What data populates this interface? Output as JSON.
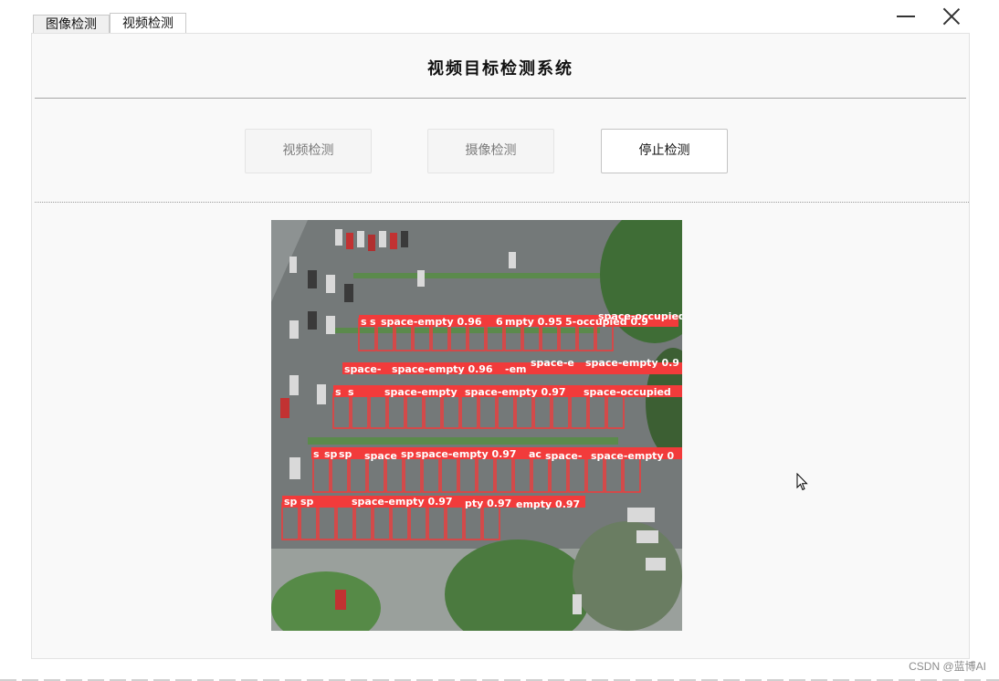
{
  "tabs": [
    {
      "label": "图像检测",
      "active": false
    },
    {
      "label": "视频检测",
      "active": true
    }
  ],
  "window": {
    "minimize_icon": "minimize-icon",
    "close_icon": "close-icon"
  },
  "panel": {
    "title": "视频目标检测系统",
    "buttons": {
      "video_detect": "视频检测",
      "camera_detect": "摄像检测",
      "stop_detect": "停止检测"
    }
  },
  "video": {
    "labels": [
      "s",
      "s",
      "space-empty 0.96",
      "6",
      "mpty 0.95",
      "5-occupied 0.9",
      "space-occupied",
      "space-",
      "space-empty 0.96",
      "-em",
      "space-e",
      "space-empty 0.9",
      "s",
      "s",
      "space-empty",
      "space-empty 0.97",
      "space-occupied",
      "s",
      "sp",
      "sp",
      "space",
      "sp",
      "space-empty 0.97",
      "ac",
      "space-",
      "space-empty 0",
      "sp",
      "sp",
      "space-empty 0.97",
      "pty 0.97",
      "empty 0.97"
    ],
    "box_color": "#f23b3b"
  },
  "watermark": "CSDN @蓝博AI"
}
